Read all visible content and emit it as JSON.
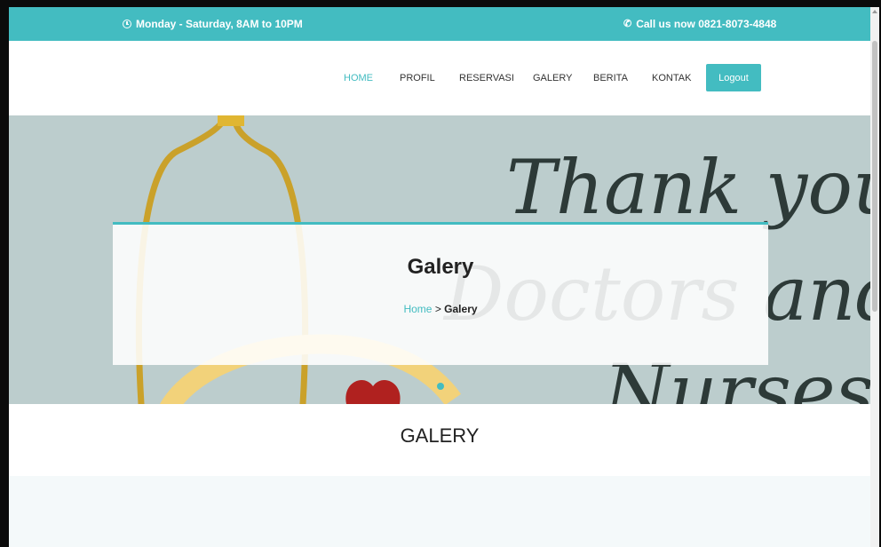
{
  "topbar": {
    "hours": "Monday - Saturday, 8AM to 10PM",
    "call": "Call us now 0821-8073-4848",
    "hours_icon": "clock-icon",
    "call_icon": "phone-icon"
  },
  "nav": {
    "items": [
      {
        "label": "HOME",
        "active": true
      },
      {
        "label": "PROFIL"
      },
      {
        "label": "RESERVASI"
      },
      {
        "label": "GALERY"
      },
      {
        "label": "BERITA"
      },
      {
        "label": "KONTAK"
      }
    ],
    "logout_label": "Logout"
  },
  "hero": {
    "title": "Galery",
    "breadcrumb_home": "Home",
    "breadcrumb_separator": " > ",
    "breadcrumb_current": "Galery",
    "image_text": "Thank you Doctors and Nurses"
  },
  "section": {
    "title": "GALERY"
  },
  "colors": {
    "accent": "#43bcc1",
    "hero_bg": "#bccdcd"
  }
}
